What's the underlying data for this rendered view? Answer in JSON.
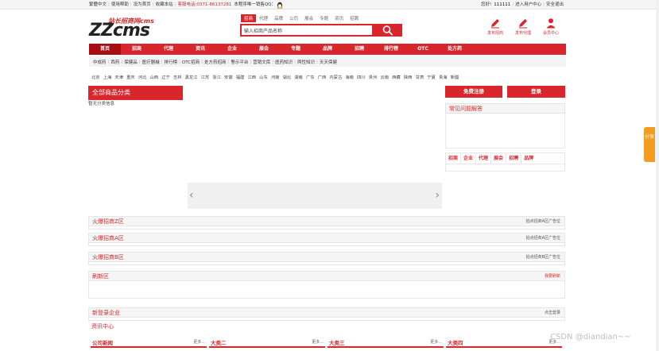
{
  "topbar": {
    "left_links": [
      "繁體中文",
      "使用帮助",
      "设为首页",
      "收藏本站"
    ],
    "hotline": "客服电话:0371-86137281",
    "qq_text": "本程序唯一销售QQ：",
    "greeting": "您好!",
    "username": "111111",
    "right_links": [
      "进入用户中心",
      "安全退出"
    ]
  },
  "logo": {
    "main": "ZZcms",
    "sub": "站长招商网cms"
  },
  "search": {
    "tabs": [
      "招商",
      "代理",
      "品牌",
      "公司",
      "展会",
      "专题",
      "资讯",
      "招聘"
    ],
    "active_tab": "招商",
    "value": "输入招商产品名称"
  },
  "user_actions": [
    {
      "label": "发布招商",
      "icon": "pencil-icon"
    },
    {
      "label": "发布代理",
      "icon": "pencil-icon"
    },
    {
      "label": "会员中心",
      "icon": "user-icon"
    }
  ],
  "nav": {
    "items": [
      "首页",
      "招商",
      "代理",
      "资讯",
      "企业",
      "展会",
      "专题",
      "品牌",
      "招聘",
      "排行榜",
      "OTC",
      "处方药"
    ],
    "active": "首页"
  },
  "subnav": [
    "中成药",
    "西药",
    "保健品",
    "医疗器械",
    "排行榜",
    "OTC招商",
    "处方药招商",
    "警示平台",
    "营销文库",
    "医药知识",
    "两性知识",
    "天天保健"
  ],
  "cities": [
    "北京",
    "上海",
    "天津",
    "重庆",
    "河北",
    "山西",
    "辽宁",
    "吉林",
    "黑龙江",
    "江苏",
    "浙江",
    "安徽",
    "福建",
    "江西",
    "山东",
    "河南",
    "湖北",
    "湖南",
    "广东",
    "广西",
    "内蒙古",
    "海南",
    "四川",
    "贵州",
    "云南",
    "西藏",
    "陕西",
    "甘肃",
    "宁夏",
    "青海",
    "新疆"
  ],
  "category": {
    "title": "全部商品分类",
    "empty": "暂无分类信息"
  },
  "sidebar": {
    "register": "免费注册",
    "login": "登录",
    "faq_title": "常见问题解答",
    "tabs": [
      "招商",
      "企业",
      "代理",
      "展会",
      "招聘",
      "品牌"
    ]
  },
  "sections": [
    {
      "title": "火爆招商Z区",
      "right": "拍点招商A区广告位"
    },
    {
      "title": "火爆招商A区",
      "right": "拍点招商A区广告位"
    },
    {
      "title": "火爆招商B区",
      "right": "拍点招商B区广告位"
    },
    {
      "title": "刷新区",
      "right": "我要刷新"
    },
    {
      "title": "新登录企业",
      "right": "点击登录"
    },
    {
      "title": "资讯中心",
      "right": ""
    }
  ],
  "news": [
    {
      "title": "公司新闻",
      "more": "更多..."
    },
    {
      "title": "大类二",
      "more": "更多..."
    },
    {
      "title": "大类三",
      "more": "更多..."
    },
    {
      "title": "大类四",
      "more": "更多..."
    }
  ],
  "share": "分享",
  "watermark": "CSDN @diandian~~",
  "colors": {
    "brand": "#d9262c",
    "nav_active": "#a80d14",
    "share": "#f39c1f"
  }
}
